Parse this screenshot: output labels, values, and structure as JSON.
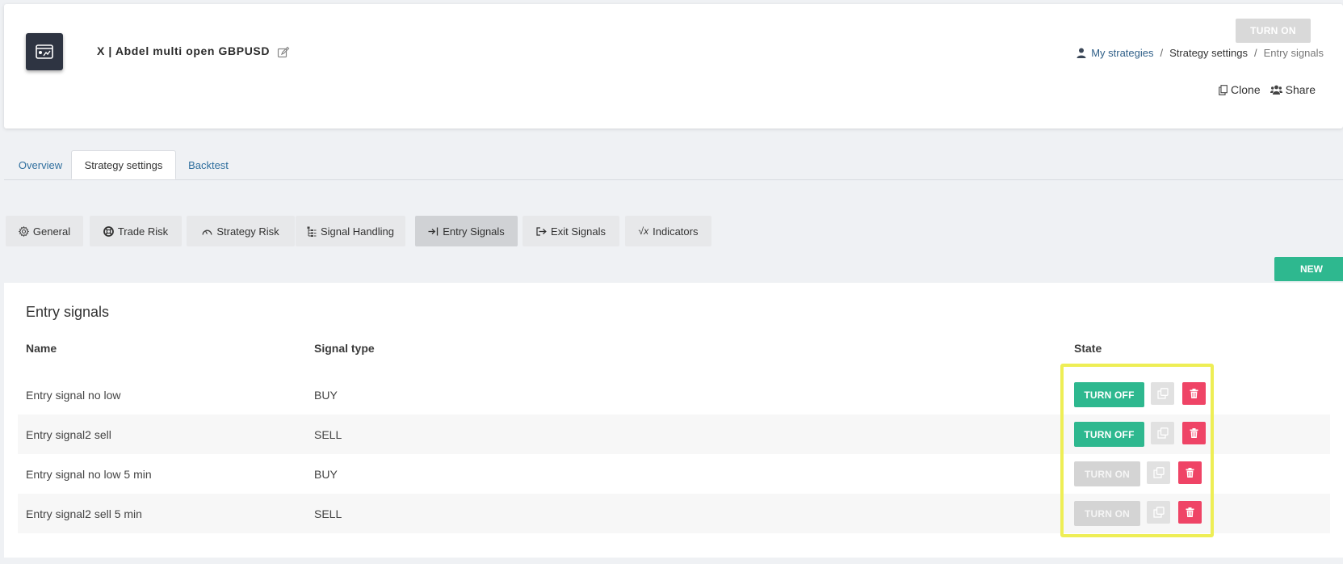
{
  "header": {
    "strategy_title": "X | Abdel multi open GBPUSD",
    "turn_on_label": "TURN ON",
    "breadcrumb": {
      "my_strategies": "My strategies",
      "strategy_settings": "Strategy settings",
      "current": "Entry signals",
      "separator": "/"
    },
    "clone_label": "Clone",
    "share_label": "Share"
  },
  "tabs": [
    {
      "label": "Overview",
      "active": false
    },
    {
      "label": "Strategy settings",
      "active": true
    },
    {
      "label": "Backtest",
      "active": false
    }
  ],
  "sections": [
    {
      "label": "General",
      "icon": "gear-icon",
      "active": false
    },
    {
      "label": "Trade Risk",
      "icon": "life-ring-icon",
      "active": false
    },
    {
      "label": "Strategy Risk",
      "icon": "gauge-icon",
      "active": false
    },
    {
      "label": "Signal Handling",
      "icon": "list-tree-icon",
      "active": false
    },
    {
      "label": "Entry Signals",
      "icon": "sign-in-icon",
      "active": true
    },
    {
      "label": "Exit Signals",
      "icon": "sign-out-icon",
      "active": false
    },
    {
      "label": "Indicators",
      "icon": "sqrt-icon",
      "active": false
    }
  ],
  "new_label": "NEW",
  "panel": {
    "title": "Entry signals",
    "columns": {
      "name": "Name",
      "signal_type": "Signal type",
      "state": "State"
    },
    "rows": [
      {
        "name": "Entry signal no low",
        "signal_type": "BUY",
        "state_label": "TURN OFF",
        "enabled": true
      },
      {
        "name": "Entry signal2 sell",
        "signal_type": "SELL",
        "state_label": "TURN OFF",
        "enabled": true
      },
      {
        "name": "Entry signal no low 5 min",
        "signal_type": "BUY",
        "state_label": "TURN ON",
        "enabled": false
      },
      {
        "name": "Entry signal2 sell 5 min",
        "signal_type": "SELL",
        "state_label": "TURN ON",
        "enabled": false
      }
    ]
  },
  "colors": {
    "accent_green": "#2eb88f",
    "delete_red": "#ef4466",
    "highlight_yellow": "#eeee55",
    "link_blue": "#2f6f9e"
  }
}
